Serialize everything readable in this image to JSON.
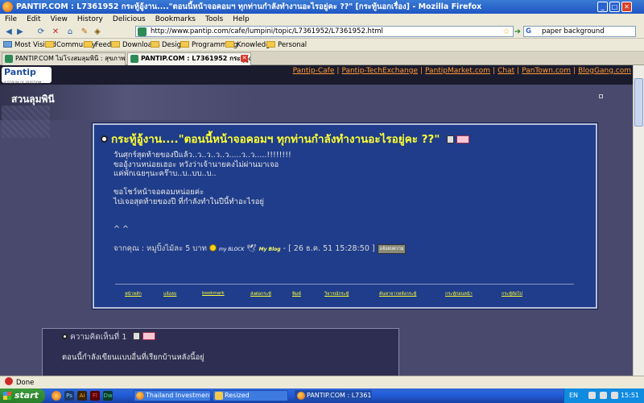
{
  "window": {
    "title": "PANTIP.COM : L7361952 กระทู้อู้งาน....\"ตอนนี้หน้าจอคอมฯ ทุกท่านกำลังทำงานอะไรอยู่คะ ??\" [กระทู้นอกเรื่อง] - Mozilla Firefox",
    "minimize": "_",
    "maximize": "□",
    "close": "✕"
  },
  "menu": [
    "File",
    "Edit",
    "View",
    "History",
    "Delicious",
    "Bookmarks",
    "Tools",
    "Help"
  ],
  "nav": {
    "url": "http://www.pantip.com/cafe/lumpini/topic/L7361952/L7361952.html",
    "search_value": "paper background",
    "search_engine_letter": "G"
  },
  "bookmarks": [
    "Most Visited",
    "Community",
    "Feeds",
    "Downloads",
    "Design",
    "Programming",
    "Knowledge",
    "Personal"
  ],
  "tabs": [
    {
      "label": "PANTIP.COM ไม่โรงสมลุมพินี : สุขภาพกา..."
    },
    {
      "label": "PANTIP.COM : L7361952 กระทู้อู้งา..."
    }
  ],
  "site": {
    "logo_text": "Pantip",
    "logo_tagline": "A FORUM OF FREEDOM",
    "top_links": [
      "Pantip-Cafe",
      "Pantip-TechExchange",
      "PantipMarket.com",
      "Chat",
      "PanTown.com",
      "BlogGang.com"
    ],
    "room_name": "สวนลุมพินี"
  },
  "topic": {
    "title": "กระทู้อู้งาน....\"ตอนนี้หน้าจอคอมฯ ทุกท่านกำลังทำงานอะไรอยู่คะ ??\"",
    "body": "วันศุกร์สุดท้ายของปีแล้ว..ว..ว..ว..ว.....ว..ว.....!!!!!!!!\nขออู้งานหน่อยเฮอะ หวังว่าเจ้านายคงไม่ผ่านมาเจอ\nแค่พักเฉยๆนะคร๊าบ..บ..บบ..บ..\n\nขอโชว์หน้าจอคอมหน่อยค่ะ\nไปเจอสุดท้ายของปี ที่กำลังทำในปีนี้ทำอะไรอยู่\n\n\n^ ^",
    "signature_prefix": "จากคุณ : หมูปิ้งไม้ละ 5 บาท",
    "my_block": "my BLOCK",
    "my_blog": "My Blog",
    "date": "- [ 26 ธ.ค. 51 15:28:50 ]",
    "reply_button": "แจ้งลบความ",
    "actions": [
      "หน้าหลัก",
      "แจ้งลบ",
      "bookmark",
      "ส่งต่อกระทู้",
      "พิมพ์",
      "วิจารณ์กระทู้",
      "ค้นหาจากหลังกระทู้",
      "กระทู้ก่อนหน้า",
      "กระทู้ถัดไป"
    ]
  },
  "reply": {
    "title": "ความคิดเห็นที่ 1",
    "body": "ตอนนี้กำลังเขียนแบบอื่นที่เรียกบ้านหลังนี้อยู่"
  },
  "status": {
    "text": "Done"
  },
  "taskbar": {
    "start": "start",
    "quicklaunch": [
      "Ps",
      "Ai",
      "Fl",
      "Dw"
    ],
    "items": [
      "Thailand Investment ...",
      "Resized",
      "PANTIP.COM : L7361..."
    ],
    "lang": "EN",
    "clock": "15:51"
  }
}
